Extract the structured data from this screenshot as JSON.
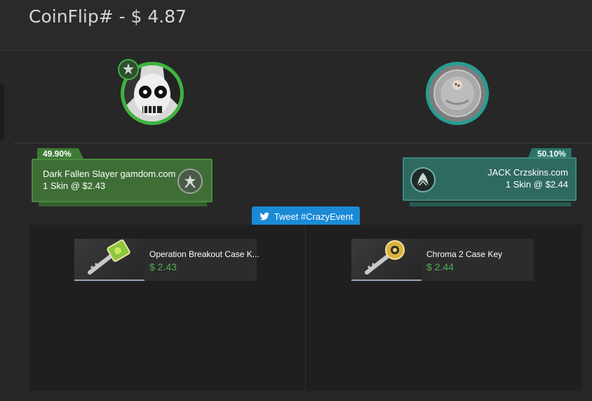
{
  "header": {
    "title": "CoinFlip# - $ 4.87"
  },
  "players": {
    "left": {
      "percent": "49.90%",
      "name": "Dark Fallen Slayer gamdom.com",
      "summary": "1 Skin @ $2.43",
      "color": "#3db33f",
      "avatar_icon": "skull-avatar-icon",
      "badge_icon": "rank-badge-icon"
    },
    "right": {
      "percent": "50.10%",
      "name": "JACK Crzskins.com",
      "summary": "1 Skin @ $2.44",
      "color": "#2a9c92",
      "avatar_icon": "coin-avatar-icon",
      "badge_icon": "team-logo-icon"
    }
  },
  "tweet": {
    "label": "Tweet #CrazyEvent",
    "color": "#1b8ad6"
  },
  "items": {
    "left": {
      "name": "Operation Breakout Case K...",
      "price": "$ 2.43"
    },
    "right": {
      "name": "Chroma 2 Case Key",
      "price": "$ 2.44"
    }
  },
  "accent_price_color": "#4caf50"
}
